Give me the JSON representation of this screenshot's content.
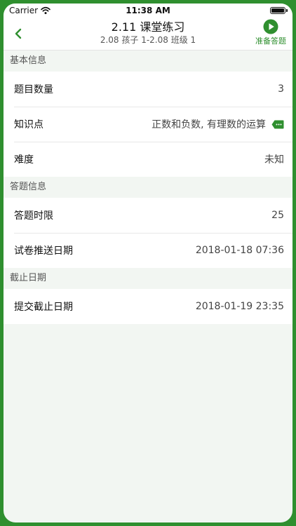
{
  "status_bar": {
    "carrier": "Carrier",
    "time": "11:38 AM",
    "wifi_icon": "wifi-icon",
    "battery_icon": "battery-icon"
  },
  "nav": {
    "back_icon": "chevron-left-icon",
    "title": "2.11 课堂练习",
    "subtitle": "2.08 孩子 1-2.08 班级 1",
    "action_icon": "play-circle-icon",
    "action_label": "准备答题"
  },
  "sections": [
    {
      "header": "基本信息",
      "rows": [
        {
          "label": "题目数量",
          "value": "3"
        },
        {
          "label": "知识点",
          "value": "正数和负数, 有理数的运算",
          "icon": "tag-icon"
        },
        {
          "label": "难度",
          "value": "未知"
        }
      ]
    },
    {
      "header": "答题信息",
      "rows": [
        {
          "label": "答题时限",
          "value": "25"
        },
        {
          "label": "试卷推送日期",
          "value": "2018-01-18 07:36"
        }
      ]
    },
    {
      "header": "截止日期",
      "rows": [
        {
          "label": "提交截止日期",
          "value": "2018-01-19 23:35"
        }
      ]
    }
  ],
  "colors": {
    "accent": "#2f8f2f",
    "background": "#f2f6f2"
  }
}
